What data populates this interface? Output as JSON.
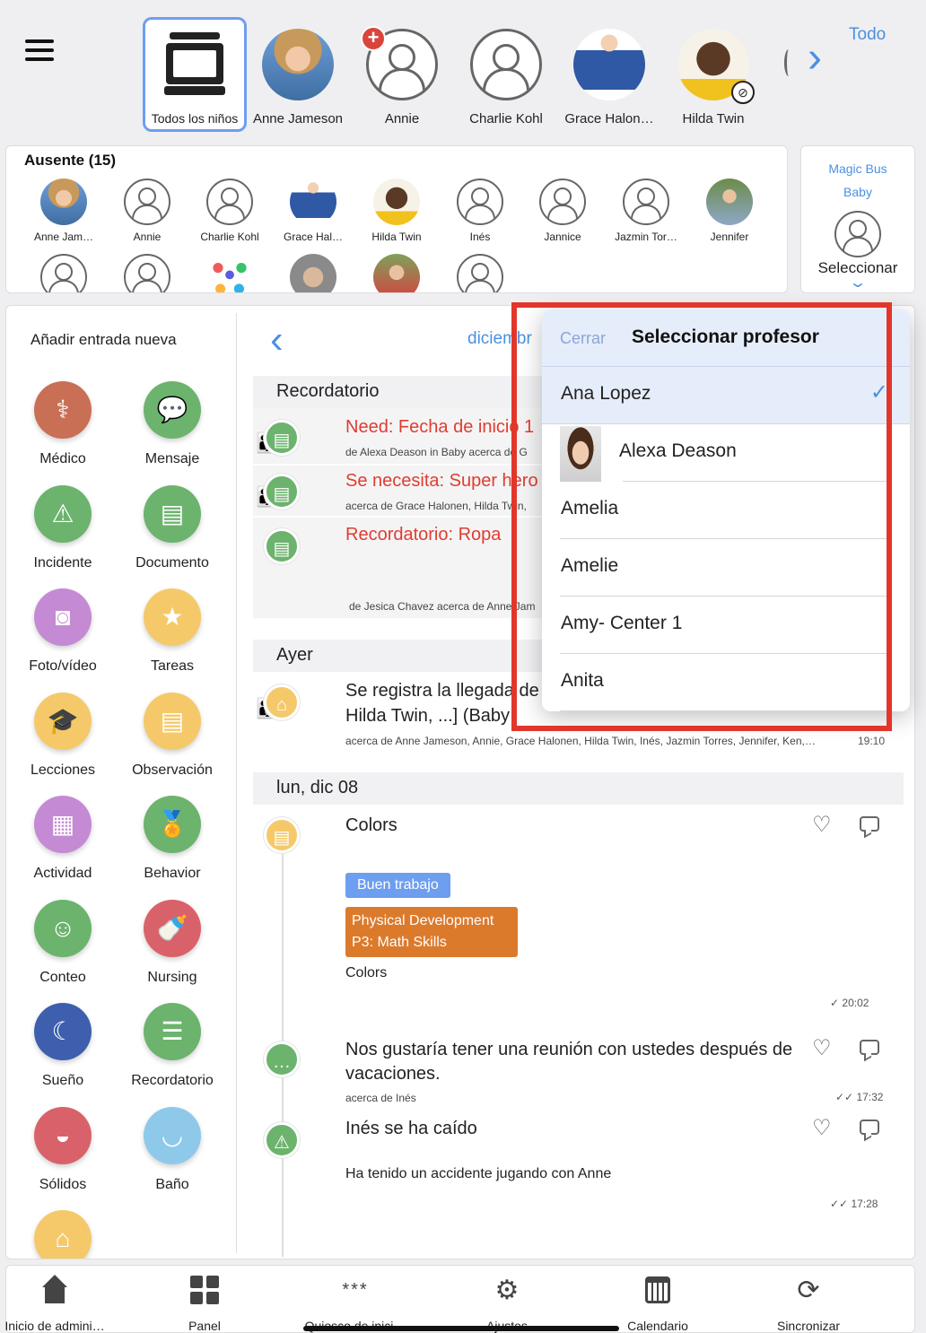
{
  "top_bar": {
    "all_kids_label": "Todos los niños",
    "children": [
      "Anne Jameson",
      "Annie",
      "Charlie Kohl",
      "Grace Halon…",
      "Hilda Twin"
    ],
    "todo_label": "Todo"
  },
  "absent": {
    "title": "Ausente (15)",
    "kids": [
      "Anne Jam…",
      "Annie",
      "Charlie Kohl",
      "Grace Hal…",
      "Hilda Twin",
      "Inés",
      "Jannice",
      "Jazmin Tor…",
      "Jennifer"
    ]
  },
  "bus": {
    "name_line1": "Magic Bus",
    "name_line2": "Baby",
    "select_label": "Seleccionar"
  },
  "sidebar": {
    "title": "Añadir entrada nueva",
    "entries": [
      {
        "label": "Médico",
        "color": "#c96f55"
      },
      {
        "label": "Mensaje",
        "color": "#6cb36e"
      },
      {
        "label": "Incidente",
        "color": "#6cb36e"
      },
      {
        "label": "Documento",
        "color": "#6cb36e"
      },
      {
        "label": "Foto/vídeo",
        "color": "#c58ad4"
      },
      {
        "label": "Tareas",
        "color": "#f5c96a"
      },
      {
        "label": "Lecciones",
        "color": "#f5c96a"
      },
      {
        "label": "Observación",
        "color": "#f5c96a"
      },
      {
        "label": "Actividad",
        "color": "#c58ad4"
      },
      {
        "label": "Behavior",
        "color": "#6cb36e"
      },
      {
        "label": "Conteo",
        "color": "#6cb36e"
      },
      {
        "label": "Nursing",
        "color": "#d9626a"
      },
      {
        "label": "Sueño",
        "color": "#3d5fae"
      },
      {
        "label": "Recordatorio",
        "color": "#6cb36e"
      },
      {
        "label": "Sólidos",
        "color": "#d9626a"
      },
      {
        "label": "Baño",
        "color": "#8fc9ea"
      }
    ]
  },
  "feed": {
    "month": "diciembr",
    "reminder_header": "Recordatorio",
    "reminders": [
      {
        "title": "Need: Fecha de inicio 1",
        "sub": "de Alexa Deason in Baby acerca de G"
      },
      {
        "title": "Se necesita: Super hero",
        "sub": "acerca de Grace Halonen, Hilda Twin,"
      },
      {
        "title": "Recordatorio: Ropa",
        "sub": "de Jesica Chavez acerca de Anne Jam"
      }
    ],
    "yesterday_header": "Ayer",
    "yesterday_item": {
      "line1": "Se registra la llegada de",
      "line2": "Hilda Twin, ...] (Baby",
      "sub": "acerca de Anne Jameson, Annie, Grace Halonen, Hilda Twin, Inés, Jazmin Torres, Jennifer, Ken,…",
      "time": "19:10"
    },
    "day_header": "lun, dic 08",
    "items": [
      {
        "title": "Colors",
        "tag1": "Buen trabajo",
        "tag2_line1": "Physical Development",
        "tag2_line2": "P3: Math Skills",
        "body": "Colors",
        "time": "✓ 20:02"
      },
      {
        "title_line1": "Nos gustaría tener una reunión con ustedes después de",
        "title_line2": "vacaciones.",
        "sub": "acerca de Inés",
        "time": "✓✓ 17:32"
      },
      {
        "title": "Inés se ha caído",
        "body": "Ha tenido un accidente jugando con Anne",
        "time": "✓✓ 17:28"
      }
    ]
  },
  "picker": {
    "close_label": "Cerrar",
    "title": "Seleccionar profesor",
    "teachers": [
      "Ana Lopez",
      "Alexa Deason",
      "Amelia",
      "Amelie",
      "Amy- Center 1",
      "Anita"
    ],
    "selected_check": "✓"
  },
  "tabs": [
    "Inicio de admini…",
    "Panel",
    "Quiosco de inici…",
    "Ajustes",
    "Calendario",
    "Sincronizar"
  ],
  "colors": {
    "accent": "#4a90e2",
    "reminder_red": "#e03c31",
    "highlight_red": "#e2362b",
    "tag_blue": "#6d9ef0",
    "tag_orange": "#dc7a2c"
  }
}
